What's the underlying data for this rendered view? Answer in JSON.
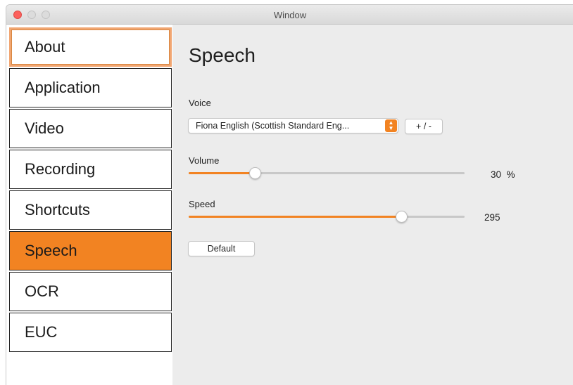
{
  "window": {
    "title": "Window"
  },
  "sidebar": {
    "items": [
      {
        "label": "About",
        "state": "focused"
      },
      {
        "label": "Application",
        "state": "normal"
      },
      {
        "label": "Video",
        "state": "normal"
      },
      {
        "label": "Recording",
        "state": "normal"
      },
      {
        "label": "Shortcuts",
        "state": "normal"
      },
      {
        "label": "Speech",
        "state": "selected"
      },
      {
        "label": "OCR",
        "state": "normal"
      },
      {
        "label": "EUC",
        "state": "normal"
      }
    ]
  },
  "main": {
    "title": "Speech",
    "voice": {
      "label": "Voice",
      "selected": "Fiona English (Scottish Standard Eng...",
      "add_remove_label": "+ / -"
    },
    "volume": {
      "label": "Volume",
      "value_text": "30  %",
      "fraction": 0.24
    },
    "speed": {
      "label": "Speed",
      "value_text": "295",
      "fraction": 0.77
    },
    "default_label": "Default"
  },
  "colors": {
    "accent": "#f28322",
    "close_button": "#fc615d",
    "sidebar_border": "#262626"
  },
  "icons": {
    "select_arrows": "updown-chevron-icon"
  }
}
